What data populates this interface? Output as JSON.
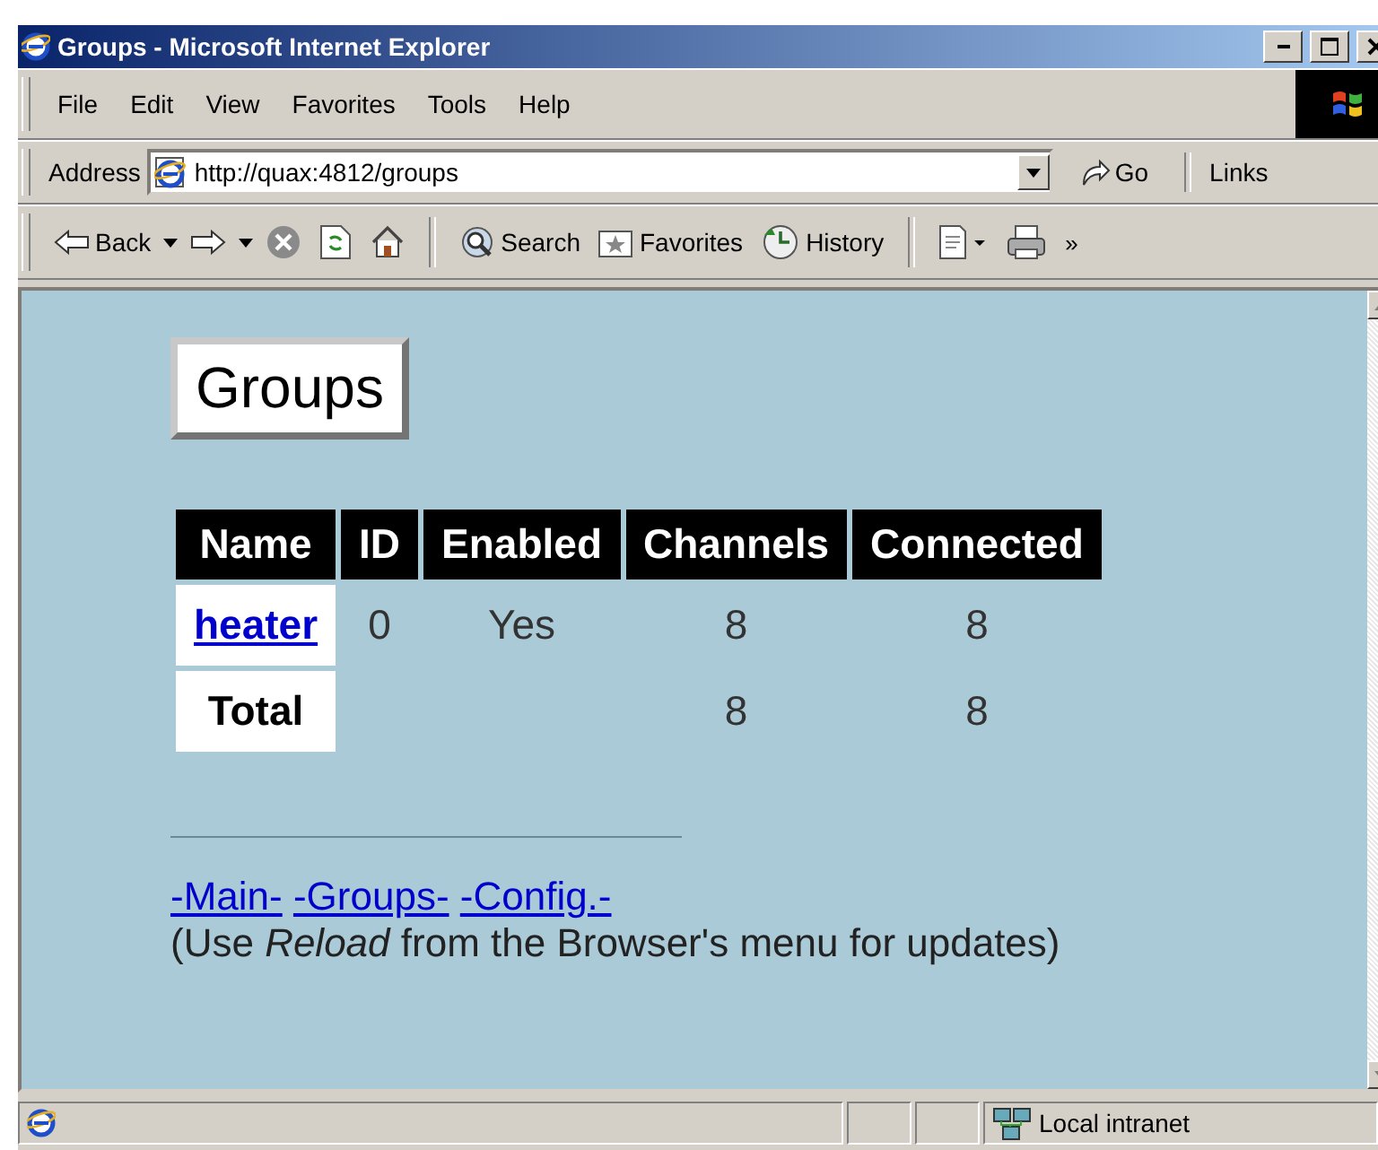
{
  "window": {
    "title": "Groups - Microsoft Internet Explorer"
  },
  "menu": [
    "File",
    "Edit",
    "View",
    "Favorites",
    "Tools",
    "Help"
  ],
  "address": {
    "label": "Address",
    "value": "http://quax:4812/groups",
    "go": "Go",
    "links": "Links"
  },
  "toolbar": [
    {
      "kind": "back",
      "label": "Back"
    },
    {
      "kind": "forward"
    },
    {
      "kind": "stop"
    },
    {
      "kind": "refresh"
    },
    {
      "kind": "home"
    },
    {
      "kind": "search",
      "label": "Search"
    },
    {
      "kind": "favorites",
      "label": "Favorites"
    },
    {
      "kind": "history",
      "label": "History"
    },
    {
      "kind": "edit"
    },
    {
      "kind": "print"
    }
  ],
  "toolbar_more": "»",
  "page": {
    "heading": "Groups",
    "table": {
      "columns": [
        "Name",
        "ID",
        "Enabled",
        "Channels",
        "Connected"
      ],
      "rows": [
        {
          "kind": "group",
          "name": "heater",
          "id": "0",
          "enabled": "Yes",
          "channels": "8",
          "connected": "8"
        },
        {
          "kind": "total",
          "name": "Total",
          "channels": "8",
          "connected": "8"
        }
      ]
    },
    "links": [
      "-Main-",
      "-Groups-",
      "-Config.-"
    ],
    "note": "(Use *Reload* from the Browser's menu for updates)"
  },
  "status_bar": {
    "zone": "Local intranet"
  }
}
